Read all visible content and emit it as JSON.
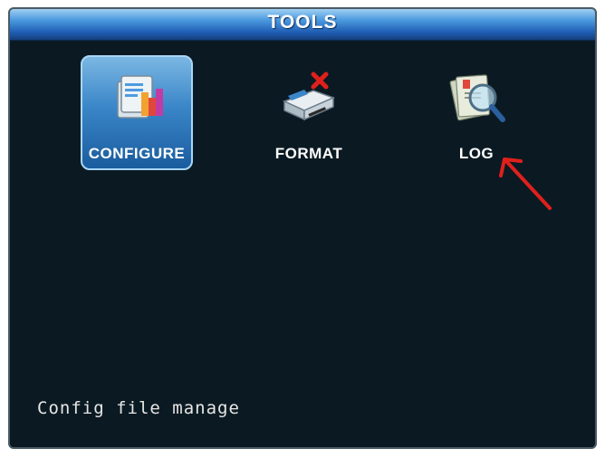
{
  "window": {
    "title": "TOOLS"
  },
  "menu": {
    "items": [
      {
        "id": "configure",
        "label": "CONFIGURE",
        "icon": "configure-icon",
        "selected": true
      },
      {
        "id": "format",
        "label": "FORMAT",
        "icon": "format-icon",
        "selected": false
      },
      {
        "id": "log",
        "label": "LOG",
        "icon": "log-icon",
        "selected": false
      }
    ]
  },
  "status": {
    "text": "Config file manage"
  },
  "colors": {
    "background": "#0b1a22",
    "titlebar": "#1f5eb4",
    "selection": "#3a86c8",
    "annotation_arrow": "#e0201c"
  }
}
